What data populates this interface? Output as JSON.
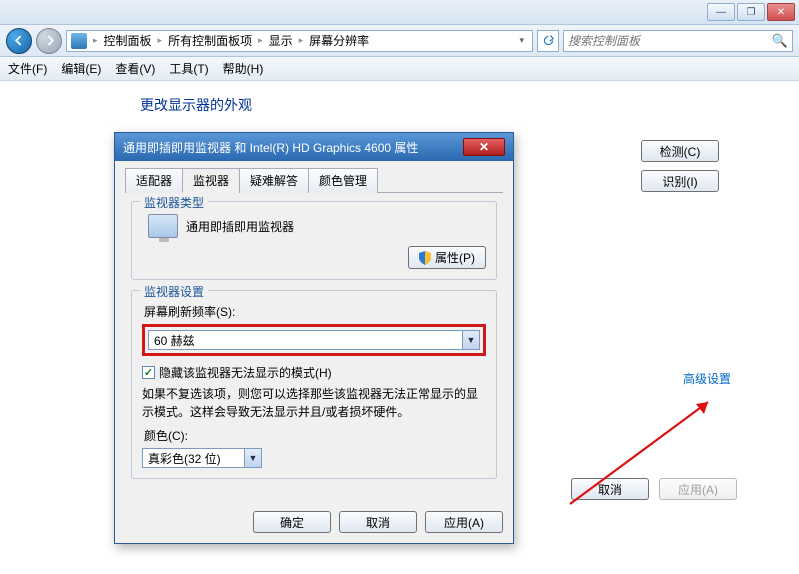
{
  "titlebar": {
    "min": "—",
    "max": "❐",
    "close": "✕"
  },
  "nav": {
    "crumb1": "控制面板",
    "crumb2": "所有控制面板项",
    "crumb3": "显示",
    "crumb4": "屏幕分辨率",
    "search_placeholder": "搜索控制面板"
  },
  "menu": {
    "file": "文件(F)",
    "edit": "编辑(E)",
    "view": "查看(V)",
    "tools": "工具(T)",
    "help": "帮助(H)"
  },
  "content": {
    "heading": "更改显示器的外观",
    "detect": "检测(C)",
    "identify": "识别(I)",
    "advanced": "高级设置",
    "cancel": "取消",
    "apply": "应用(A)"
  },
  "dialog": {
    "title": "通用即插即用监视器 和 Intel(R) HD Graphics 4600 属性",
    "tabs": {
      "adapter": "适配器",
      "monitor": "监视器",
      "troubleshoot": "疑难解答",
      "color": "颜色管理"
    },
    "group1": {
      "title": "监视器类型",
      "name": "通用即插即用监视器",
      "properties": "属性(P)"
    },
    "group2": {
      "title": "监视器设置",
      "refresh_label": "屏幕刷新频率(S):",
      "refresh_value": "60 赫兹",
      "hide_modes": "隐藏该监视器无法显示的模式(H)",
      "note": "如果不复选该项，则您可以选择那些该监视器无法正常显示的显示模式。这样会导致无法显示并且/或者损坏硬件。",
      "color_label": "颜色(C):",
      "color_value": "真彩色(32 位)"
    },
    "buttons": {
      "ok": "确定",
      "cancel": "取消",
      "apply": "应用(A)"
    }
  }
}
